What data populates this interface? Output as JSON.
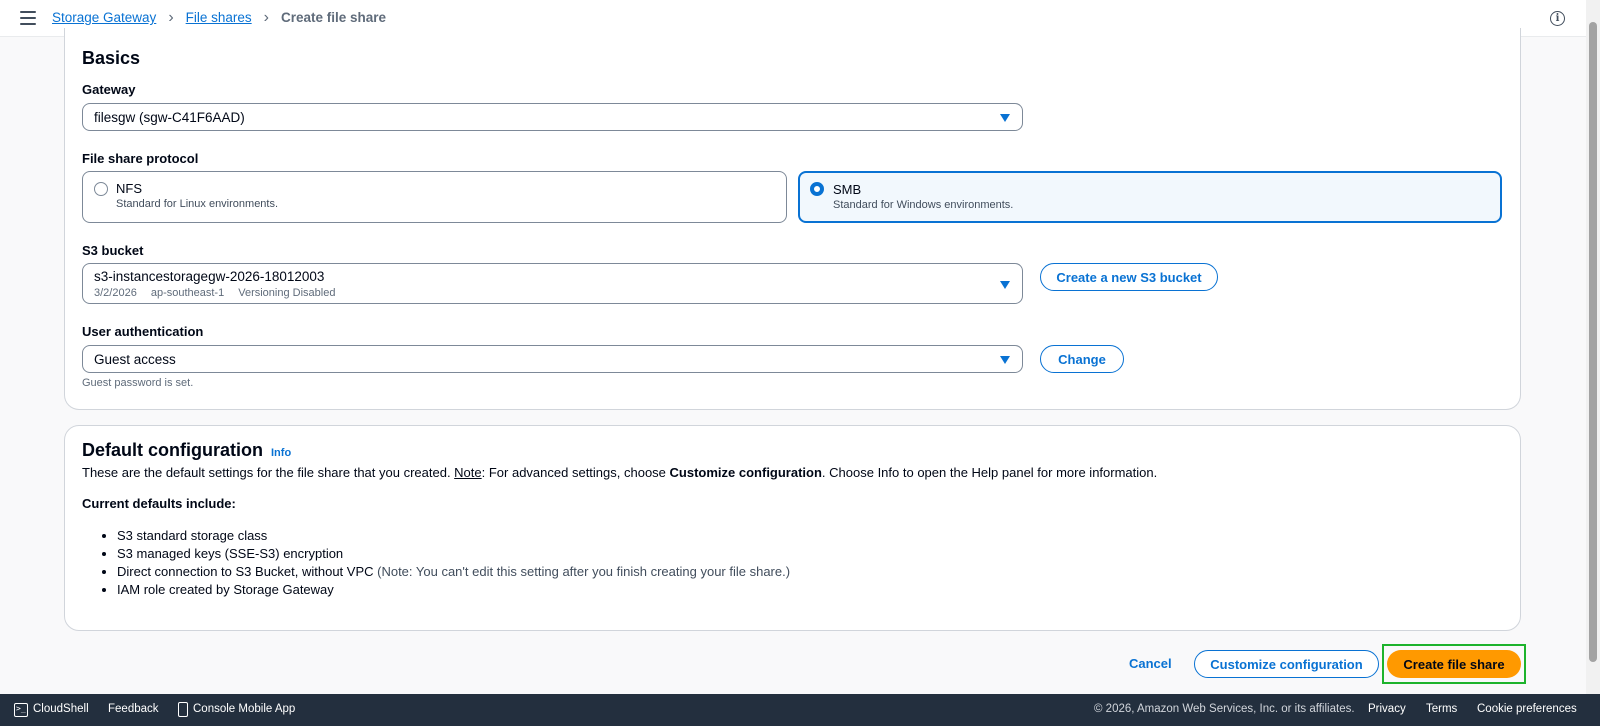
{
  "breadcrumb": {
    "items": [
      "Storage Gateway",
      "File shares"
    ],
    "current": "Create file share"
  },
  "basics": {
    "title": "Basics",
    "gateway": {
      "label": "Gateway",
      "value": "filesgw (sgw-C41F6AAD)"
    },
    "protocol": {
      "label": "File share protocol",
      "options": [
        {
          "title": "NFS",
          "description": "Standard for Linux environments.",
          "selected": false
        },
        {
          "title": "SMB",
          "description": "Standard for Windows environments.",
          "selected": true
        }
      ]
    },
    "s3": {
      "label": "S3 bucket",
      "value": "s3-instancestoragegw-2026-18012003",
      "date": "3/2/2026",
      "region": "ap-southeast-1",
      "versioning": "Versioning Disabled",
      "create_button": "Create a new S3 bucket"
    },
    "auth": {
      "label": "User authentication",
      "value": "Guest access",
      "change_button": "Change",
      "hint": "Guest password is set."
    }
  },
  "defaults": {
    "title": "Default configuration",
    "info": "Info",
    "desc_1": "These are the default settings for the file share that you created. ",
    "desc_note": "Note",
    "desc_2": ": For advanced settings, choose ",
    "desc_bold": "Customize configuration",
    "desc_3": ". Choose Info to open the Help panel for more information.",
    "current_label": "Current defaults include:",
    "items": [
      "S3 standard storage class",
      "S3 managed keys (SSE-S3) encryption",
      "Direct connection to S3 Bucket, without VPC",
      "IAM role created by Storage Gateway"
    ],
    "item3_note": " (Note: You can't edit this setting after you finish creating your file share.)"
  },
  "actions": {
    "cancel": "Cancel",
    "customize": "Customize configuration",
    "create": "Create file share"
  },
  "footer": {
    "cloudshell": "CloudShell",
    "feedback": "Feedback",
    "mobile": "Console Mobile App",
    "copyright": "© 2026, Amazon Web Services, Inc. or its affiliates.",
    "privacy": "Privacy",
    "terms": "Terms",
    "cookies": "Cookie preferences"
  },
  "colors": {
    "link": "#0972d3",
    "primary": "#ff9900",
    "footer_bg": "#232f3e",
    "focus": "#1db32c"
  }
}
